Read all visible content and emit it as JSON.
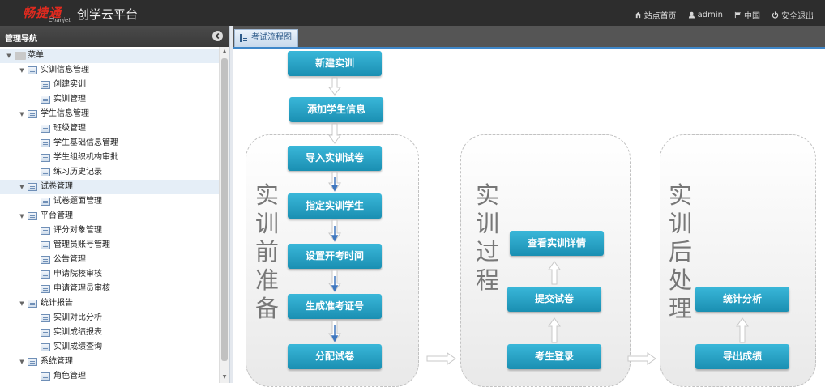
{
  "header": {
    "logo_text": "畅捷通",
    "logo_sub": "Chanjet",
    "app_title": "创学云平台",
    "links": [
      {
        "label": "站点首页",
        "icon": "home-icon"
      },
      {
        "label": "admin",
        "icon": "user-icon"
      },
      {
        "label": "中国",
        "icon": "flag-icon"
      },
      {
        "label": "安全退出",
        "icon": "power-icon"
      }
    ]
  },
  "sidebar": {
    "title": "管理导航",
    "tree": [
      {
        "label": "菜单",
        "level": 0,
        "type": "root",
        "expanded": true,
        "selected": true
      },
      {
        "label": "实训信息管理",
        "level": 1,
        "type": "group",
        "expanded": true
      },
      {
        "label": "创建实训",
        "level": 2,
        "type": "leaf"
      },
      {
        "label": "实训管理",
        "level": 2,
        "type": "leaf"
      },
      {
        "label": "学生信息管理",
        "level": 1,
        "type": "group",
        "expanded": true
      },
      {
        "label": "班级管理",
        "level": 2,
        "type": "leaf"
      },
      {
        "label": "学生基础信息管理",
        "level": 2,
        "type": "leaf"
      },
      {
        "label": "学生组织机构审批",
        "level": 2,
        "type": "leaf"
      },
      {
        "label": "练习历史记录",
        "level": 2,
        "type": "leaf"
      },
      {
        "label": "试卷管理",
        "level": 1,
        "type": "group",
        "expanded": true,
        "selected": true
      },
      {
        "label": "试卷题面管理",
        "level": 2,
        "type": "leaf"
      },
      {
        "label": "平台管理",
        "level": 1,
        "type": "group",
        "expanded": true
      },
      {
        "label": "评分对象管理",
        "level": 2,
        "type": "leaf"
      },
      {
        "label": "管理员账号管理",
        "level": 2,
        "type": "leaf"
      },
      {
        "label": "公告管理",
        "level": 2,
        "type": "leaf"
      },
      {
        "label": "申请院校审核",
        "level": 2,
        "type": "leaf"
      },
      {
        "label": "申请管理员审核",
        "level": 2,
        "type": "leaf"
      },
      {
        "label": "统计报告",
        "level": 1,
        "type": "group",
        "expanded": true
      },
      {
        "label": "实训对比分析",
        "level": 2,
        "type": "leaf"
      },
      {
        "label": "实训成绩报表",
        "level": 2,
        "type": "leaf"
      },
      {
        "label": "实训成绩查询",
        "level": 2,
        "type": "leaf"
      },
      {
        "label": "系统管理",
        "level": 1,
        "type": "group",
        "expanded": true
      },
      {
        "label": "角色管理",
        "level": 2,
        "type": "leaf"
      }
    ]
  },
  "tabs": [
    {
      "label": "考试流程图",
      "active": true
    }
  ],
  "flow": {
    "stages": [
      {
        "title": "实训前准备"
      },
      {
        "title": "实训过程"
      },
      {
        "title": "实训后处理"
      }
    ],
    "steps": [
      "新建实训",
      "添加学生信息",
      "导入实训试卷",
      "指定实训学生",
      "设置开考时间",
      "生成准考证号",
      "分配试卷",
      "考生登录",
      "提交试卷",
      "查看实训详情",
      "导出成绩",
      "统计分析"
    ]
  }
}
